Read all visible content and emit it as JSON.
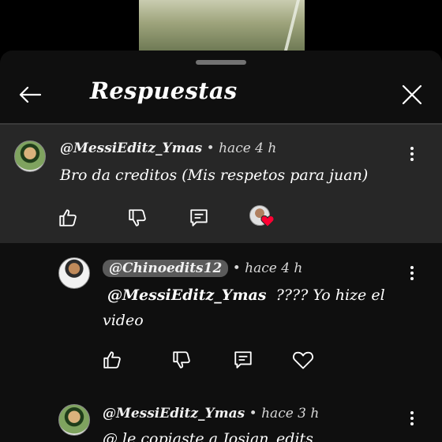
{
  "header": {
    "title": "Respuestas"
  },
  "comments": [
    {
      "author": "@MessiEditz_Ymas",
      "separator": "•",
      "time": "hace 4 h",
      "text": "Bro da creditos (Mis respetos para juan)",
      "liked_by_creator": true
    },
    {
      "author": "@Chinoedits12",
      "author_highlighted": true,
      "separator": "•",
      "time": "hace 4 h",
      "mention": "@MessiEditz_Ymas",
      "text_line1": "???? Yo hize el",
      "text_line2": "video"
    },
    {
      "author": "@MessiEditz_Ymas",
      "separator": "•",
      "time": "hace 3 h",
      "text": "@ le copiaste a Josian_edits"
    }
  ],
  "icons": {
    "back": "arrow-left-icon",
    "close": "close-icon",
    "like": "thumbs-up-icon",
    "dislike": "thumbs-down-icon",
    "reply": "reply-icon",
    "heart": "heart-icon",
    "more": "more-vert-icon"
  },
  "colors": {
    "heart_red": "#ff0033",
    "chip_bg": "#5a5a5a",
    "highlight_bg": "#272727"
  }
}
